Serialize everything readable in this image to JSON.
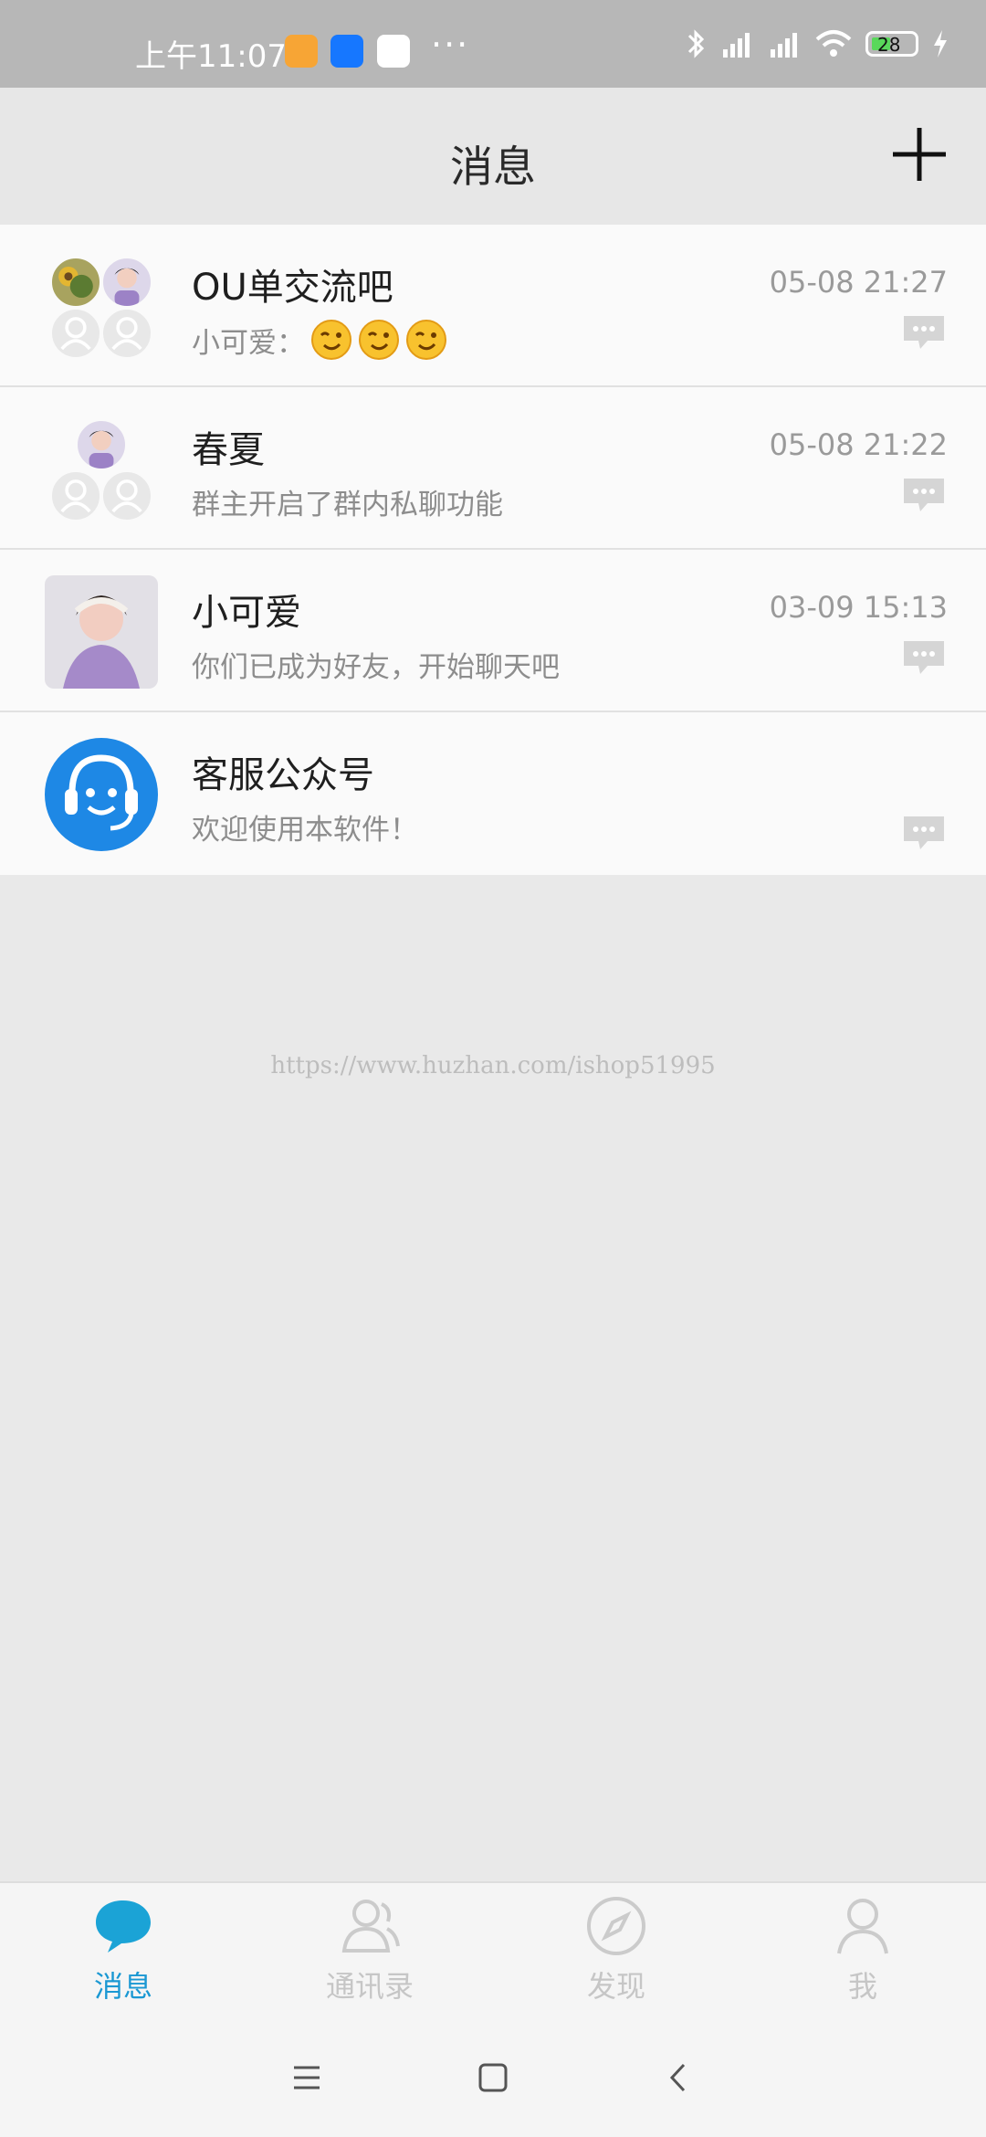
{
  "status_bar": {
    "time": "上午11:07",
    "more": "···",
    "battery": "28",
    "app_icons": [
      "message-notification-icon",
      "alipay-icon",
      "video-player-icon"
    ]
  },
  "header": {
    "title": "消息",
    "add_icon": "plus-icon"
  },
  "conversations": [
    {
      "name": "OU单交流吧",
      "sender": "小可爱：",
      "preview": "",
      "emojis": [
        "winking-face-emoji",
        "winking-face-emoji",
        "winking-face-emoji"
      ],
      "time": "05-08 21:27",
      "type": "group"
    },
    {
      "name": "春夏",
      "sender": "",
      "preview": "群主开启了群内私聊功能",
      "time": "05-08 21:22",
      "type": "group"
    },
    {
      "name": "小可爱",
      "sender": "",
      "preview": "你们已成为好友，开始聊天吧",
      "time": "03-09 15:13",
      "type": "person"
    },
    {
      "name": "客服公众号",
      "sender": "",
      "preview": "欢迎使用本软件！",
      "time": "",
      "type": "service"
    }
  ],
  "watermark": "https://www.huzhan.com/ishop51995",
  "bottom_nav": [
    {
      "label": "消息",
      "icon": "chat-bubble-icon",
      "active": true
    },
    {
      "label": "通讯录",
      "icon": "contacts-icon",
      "active": false
    },
    {
      "label": "发现",
      "icon": "compass-icon",
      "active": false
    },
    {
      "label": "我",
      "icon": "profile-icon",
      "active": false
    }
  ],
  "system_nav": [
    "menu-icon",
    "home-icon",
    "back-icon"
  ],
  "colors": {
    "accent": "#1a98d3",
    "service_avatar": "#1e88e5"
  }
}
